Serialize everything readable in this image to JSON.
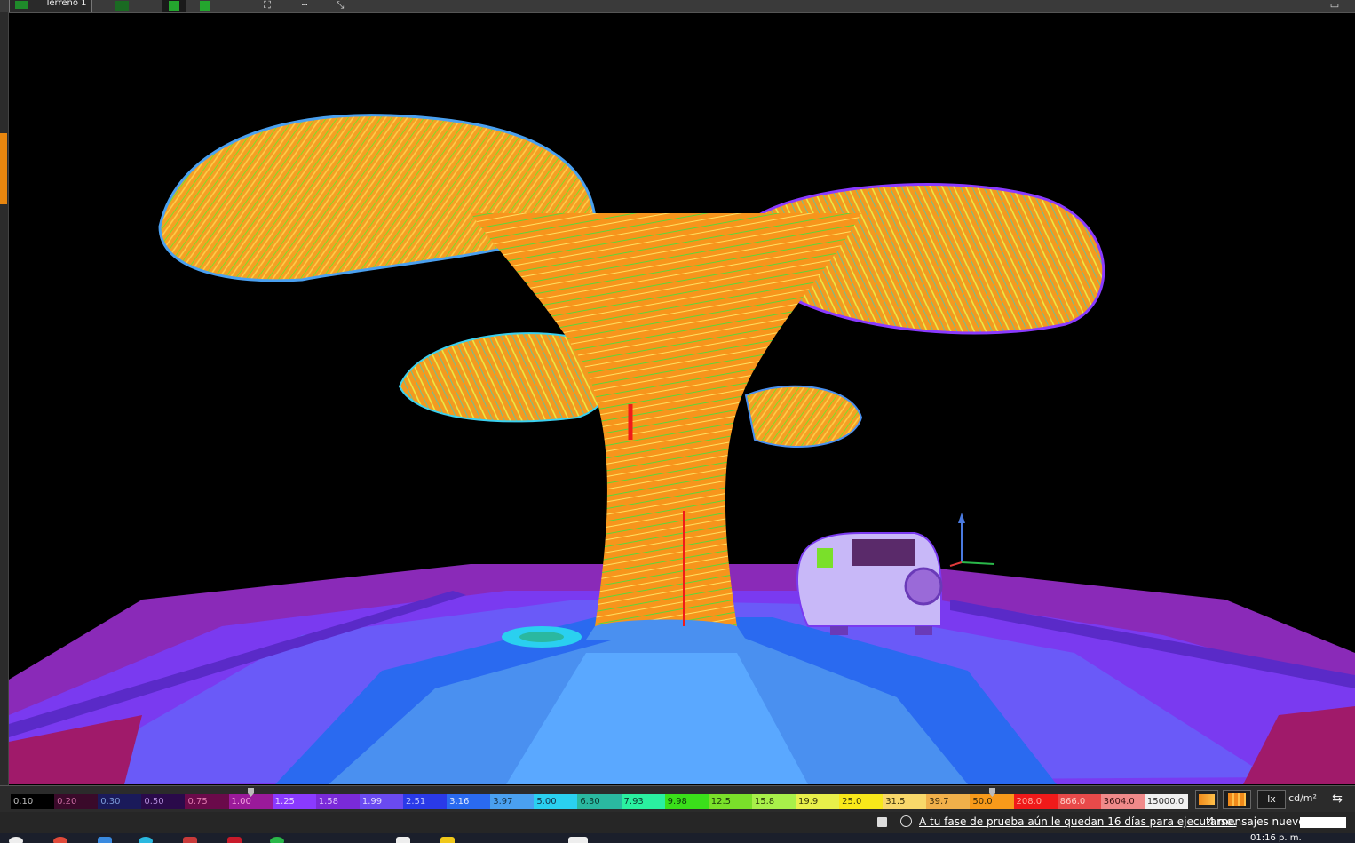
{
  "toolbar": {
    "tab_label": "Terreno 1",
    "tools": [
      "add-object-icon",
      "green-square-icon",
      "green-layer-icon",
      "fit-view-icon",
      "ruler-icon",
      "measure-icon"
    ],
    "monitor_icon": "monitor-icon"
  },
  "viewport": {
    "description_type": "false-color luminance render",
    "accent": "#ff9a1a"
  },
  "legend": {
    "items": [
      {
        "value": "0.10",
        "color": "#000000",
        "text_color": "#bbbbbb"
      },
      {
        "value": "0.20",
        "color": "#3a0a2a",
        "text_color": "#c86aa0"
      },
      {
        "value": "0.30",
        "color": "#1a1a5a",
        "text_color": "#7a9ad8"
      },
      {
        "value": "0.50",
        "color": "#2a0a4a",
        "text_color": "#b08ad8"
      },
      {
        "value": "0.75",
        "color": "#6a0a4a",
        "text_color": "#e27ab0"
      },
      {
        "value": "1.00",
        "color": "#9a1a9a",
        "text_color": "#f5a0e0"
      },
      {
        "value": "1.25",
        "color": "#8a3aff",
        "text_color": "#e8d0ff"
      },
      {
        "value": "1.58",
        "color": "#7a2ad8",
        "text_color": "#e0c0ff"
      },
      {
        "value": "1.99",
        "color": "#6a4af0",
        "text_color": "#e0d8ff"
      },
      {
        "value": "2.51",
        "color": "#2a3ae8",
        "text_color": "#c0c8ff"
      },
      {
        "value": "3.16",
        "color": "#2a6af0",
        "text_color": "#e0eaff"
      },
      {
        "value": "3.97",
        "color": "#4aa0f0",
        "text_color": "#14324a"
      },
      {
        "value": "5.00",
        "color": "#2ad0f0",
        "text_color": "#14324a"
      },
      {
        "value": "6.30",
        "color": "#2ab8a0",
        "text_color": "#0a3a30"
      },
      {
        "value": "7.93",
        "color": "#2af0a0",
        "text_color": "#0a3a30"
      },
      {
        "value": "9.98",
        "color": "#3ae01a",
        "text_color": "#0a3a0a"
      },
      {
        "value": "12.5",
        "color": "#7ae02a",
        "text_color": "#1a3a0a"
      },
      {
        "value": "15.8",
        "color": "#a8f04a",
        "text_color": "#2a3a0a"
      },
      {
        "value": "19.9",
        "color": "#e8f04a",
        "text_color": "#3a3a0a"
      },
      {
        "value": "25.0",
        "color": "#f8e81a",
        "text_color": "#3a3a0a"
      },
      {
        "value": "31.5",
        "color": "#f8d86a",
        "text_color": "#3a300a"
      },
      {
        "value": "39.7",
        "color": "#f0b04a",
        "text_color": "#3a2a0a"
      },
      {
        "value": "50.0",
        "color": "#f89a1a",
        "text_color": "#3a2a0a"
      },
      {
        "value": "208.0",
        "color": "#f01a1a",
        "text_color": "#ffb0a0"
      },
      {
        "value": "866.0",
        "color": "#e84a4a",
        "text_color": "#ffd0c8"
      },
      {
        "value": "3604.0",
        "color": "#f08a8a",
        "text_color": "#3a1010"
      },
      {
        "value": "15000.0",
        "color": "#f0f0f0",
        "text_color": "#303030"
      }
    ],
    "unit_lx": "lx",
    "unit_cd": "cd/m²",
    "palette_icons": [
      "orange-gradient-icon",
      "orange-bands-icon"
    ],
    "swap_icon": "swap-arrows-icon"
  },
  "status": {
    "trial_message": "A tu fase de prueba aún le quedan 16 días para ejecutarse.",
    "messages": "4 mensajes nuevos"
  },
  "taskbar": {
    "time": "01:16 p. m."
  }
}
